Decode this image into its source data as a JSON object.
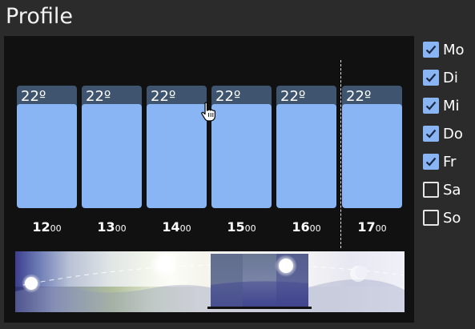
{
  "title": "Profile",
  "slots": [
    {
      "temp": "22º",
      "hour": "12",
      "min": "00"
    },
    {
      "temp": "22º",
      "hour": "13",
      "min": "00"
    },
    {
      "temp": "22º",
      "hour": "14",
      "min": "00"
    },
    {
      "temp": "22º",
      "hour": "15",
      "min": "00"
    },
    {
      "temp": "22º",
      "hour": "16",
      "min": "00"
    },
    {
      "temp": "22º",
      "hour": "17",
      "min": "00"
    }
  ],
  "days": [
    {
      "label": "Mo",
      "checked": true
    },
    {
      "label": "Di",
      "checked": true
    },
    {
      "label": "Mi",
      "checked": true
    },
    {
      "label": "Do",
      "checked": true
    },
    {
      "label": "Fr",
      "checked": true
    },
    {
      "label": "Sa",
      "checked": false
    },
    {
      "label": "So",
      "checked": false
    }
  ],
  "colors": {
    "background": "#2b2b2b",
    "panel": "#111111",
    "slot_track": "#3f546e",
    "slot_fill": "#8ab5f5",
    "checkbox_accent": "#8ab5f5"
  },
  "icons": {
    "cursor": "hand-cursor-icon",
    "checkmark": "checkmark-icon",
    "sun": "sun-icon",
    "moon": "moon-icon"
  }
}
